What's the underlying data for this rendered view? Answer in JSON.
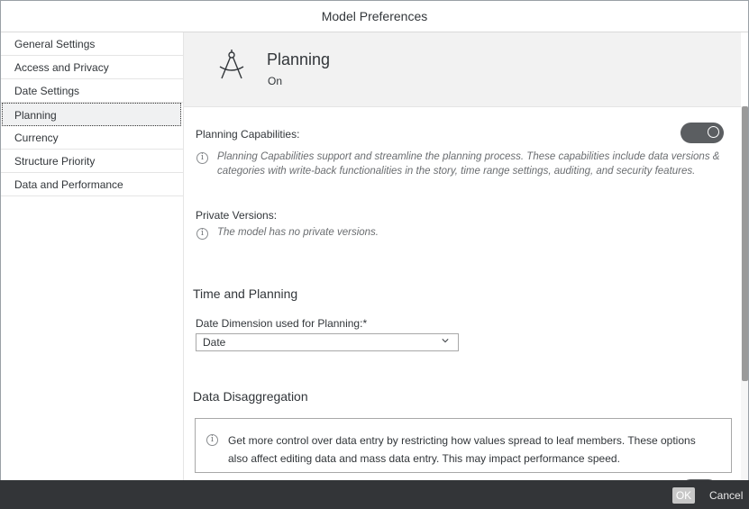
{
  "dialog": {
    "title": "Model Preferences"
  },
  "sidebar": {
    "items": [
      {
        "label": "General Settings"
      },
      {
        "label": "Access and Privacy"
      },
      {
        "label": "Date Settings"
      },
      {
        "label": "Planning",
        "selected": true
      },
      {
        "label": "Currency"
      },
      {
        "label": "Structure Priority"
      },
      {
        "label": "Data and Performance"
      }
    ]
  },
  "header": {
    "icon": "compass-icon",
    "title": "Planning",
    "subtitle": "On"
  },
  "planning": {
    "capabilities_label": "Planning Capabilities:",
    "capabilities_toggle": "on",
    "capabilities_info": "Planning Capabilities support and streamline the planning process. These capabilities include data versions & categories with write-back functionalities in the story, time range settings, auditing, and security features.",
    "private_versions_label": "Private Versions:",
    "private_versions_info": "The model has no private versions."
  },
  "time_planning": {
    "title": "Time and Planning",
    "date_dimension_label": "Date Dimension used for Planning:",
    "required_mark": "*",
    "date_dimension_value": "Date"
  },
  "data_disaggregation": {
    "title": "Data Disaggregation",
    "info": "Get more control over data entry by restricting how values spread to leaf members. These options also affect editing data and mass data entry. This may impact performance speed."
  },
  "footer": {
    "ok_label": "OK",
    "cancel_label": "Cancel"
  },
  "colors": {
    "toggle_on": "#5b5e61",
    "footer_bg": "#333538",
    "header_bg": "#f2f2f2"
  }
}
